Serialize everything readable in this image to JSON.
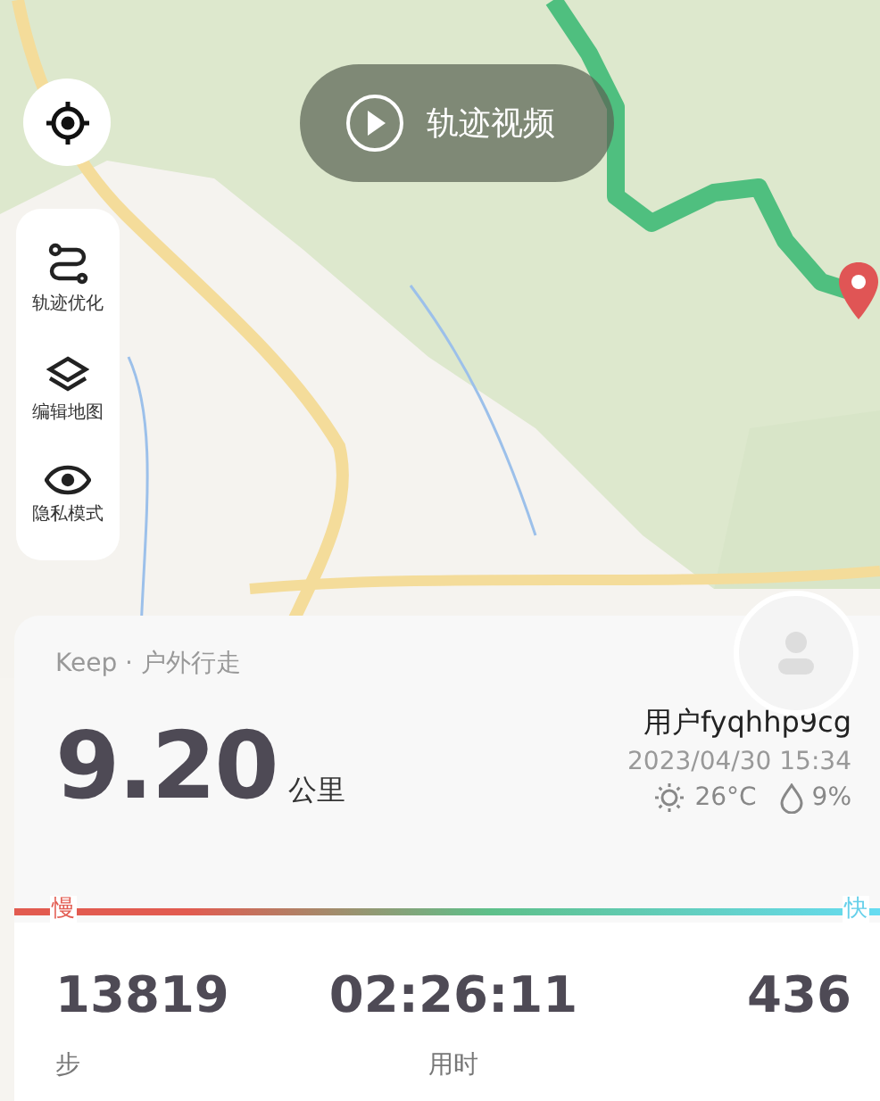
{
  "track_video_button": {
    "label": "轨迹视频"
  },
  "side_tools": [
    {
      "kind": "route",
      "label": "轨迹优化"
    },
    {
      "kind": "layers",
      "label": "编辑地图"
    },
    {
      "kind": "eye",
      "label": "隐私模式"
    }
  ],
  "summary": {
    "source": "Keep · 户外行走",
    "distance": "9.20",
    "unit": "公里",
    "user": "用户fyqhhp9cg",
    "datetime": "2023/04/30 15:34",
    "temperature": "26°C",
    "humidity": "9%"
  },
  "speed_legend": {
    "slow": "慢",
    "fast": "快"
  },
  "stats": [
    {
      "value": "13819",
      "label": "步"
    },
    {
      "value": "02:26:11",
      "label": "用时"
    },
    {
      "value": "436"
    }
  ]
}
